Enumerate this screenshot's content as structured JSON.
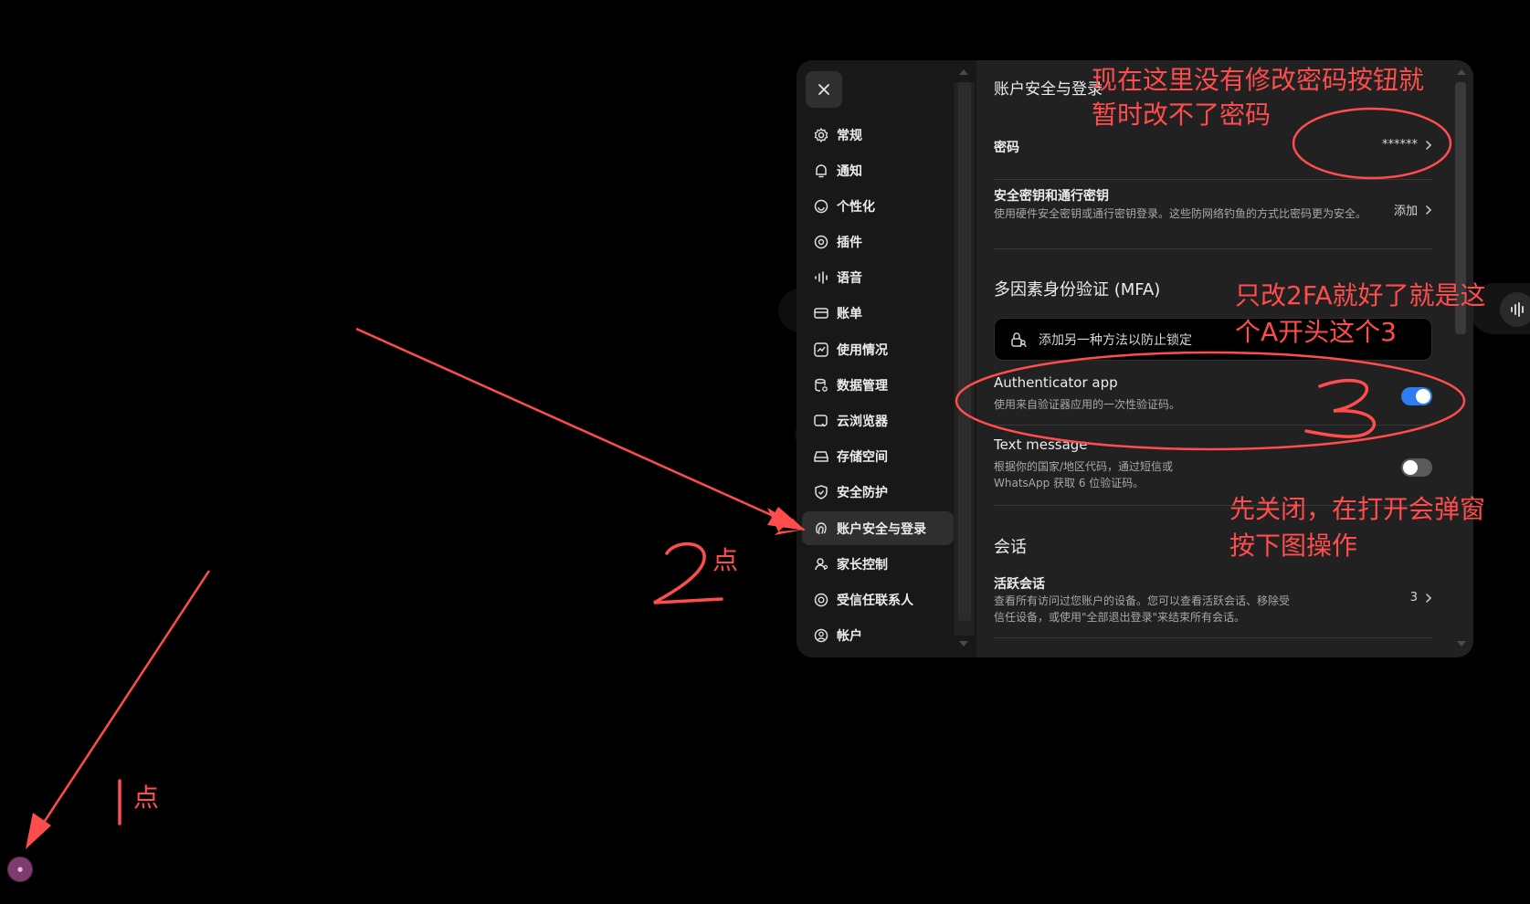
{
  "dialog": {
    "close_label": "×",
    "nav_items": [
      {
        "label": "常规",
        "icon": "gear-icon"
      },
      {
        "label": "通知",
        "icon": "bell-icon"
      },
      {
        "label": "个性化",
        "icon": "palette-icon"
      },
      {
        "label": "插件",
        "icon": "plugin-icon"
      },
      {
        "label": "语音",
        "icon": "waveform-icon"
      },
      {
        "label": "账单",
        "icon": "card-icon"
      },
      {
        "label": "使用情况",
        "icon": "chart-icon"
      },
      {
        "label": "数据管理",
        "icon": "database-icon"
      },
      {
        "label": "云浏览器",
        "icon": "cloud-browser-icon"
      },
      {
        "label": "存储空间",
        "icon": "storage-icon"
      },
      {
        "label": "安全防护",
        "icon": "shield-icon"
      },
      {
        "label": "账户安全与登录",
        "icon": "fingerprint-icon",
        "active": true
      },
      {
        "label": "家长控制",
        "icon": "person-icon"
      },
      {
        "label": "受信任联系人",
        "icon": "lifebuoy-icon"
      },
      {
        "label": "帐户",
        "icon": "user-circle-icon"
      }
    ]
  },
  "content": {
    "title": "账户安全与登录",
    "password": {
      "label": "密码",
      "value": "******"
    },
    "security_keys": {
      "title": "安全密钥和通行密钥",
      "desc": "使用硬件安全密钥或通行密钥登录。这些防网络钓鱼的方式比密码更为安全。",
      "action": "添加"
    },
    "mfa": {
      "heading": "多因素身份验证 (MFA)",
      "add_method": "添加另一种方法以防止锁定",
      "authenticator": {
        "title": "Authenticator app",
        "desc": "使用来自验证器应用的一次性验证码。",
        "enabled": true
      },
      "text_message": {
        "title": "Text message",
        "desc": "根据你的国家/地区代码，通过短信或 WhatsApp 获取 6 位验证码。",
        "enabled": false
      }
    },
    "sessions": {
      "heading": "会话",
      "active": {
        "title": "活跃会话",
        "desc": "查看所有访问过您账户的设备。您可以查看活跃会话、移除受信任设备，或使用\"全部退出登录\"来结束所有会话。",
        "count": "3"
      }
    }
  },
  "annotations": {
    "top_note_line1": "现在这里没有修改密码按钮就",
    "top_note_line2": "暂时改不了密码",
    "mfa_note_line1": "只改2FA就好了就是这",
    "mfa_note_line2": "个A开头这个3",
    "toggle_note_line1": "先关闭，在打开会弹窗",
    "toggle_note_line2": "按下图操作",
    "step2_digit": "2",
    "step2_label": "点",
    "step1_digit": "1",
    "step1_label": "点",
    "step3_digit": "3"
  },
  "colors": {
    "annotation": "#ff4d4d",
    "toggle_on": "#2f7bf0",
    "toggle_off": "#5a5a5a",
    "avatar": "#7d3b6e"
  }
}
